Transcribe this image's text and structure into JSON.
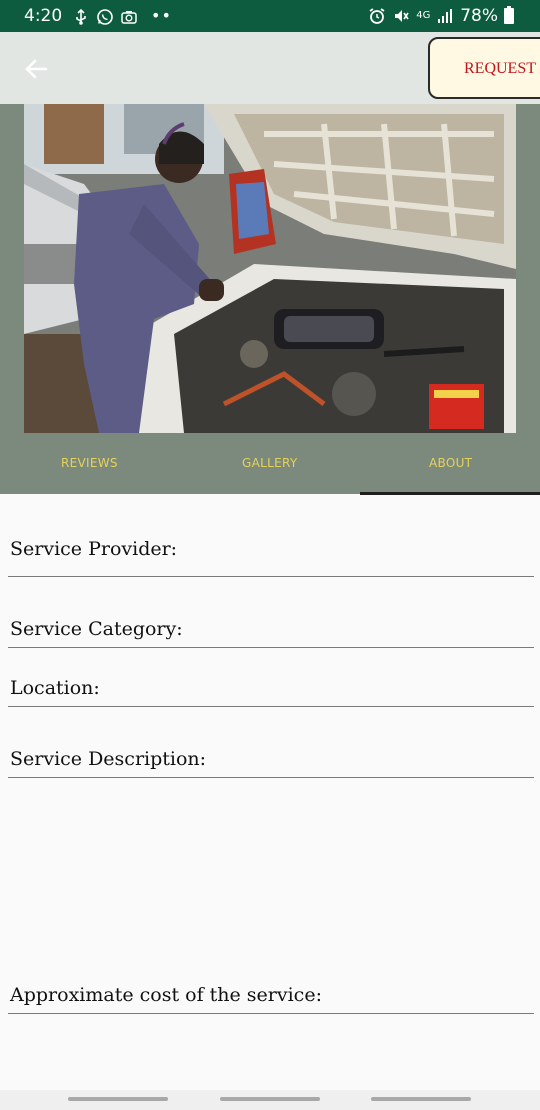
{
  "status_bar": {
    "time": "4:20",
    "dots": "••",
    "network": "4G",
    "battery": "78%",
    "icons": [
      "usb-icon",
      "whatsapp-icon",
      "camera-icon",
      "alarm-icon",
      "mute-icon",
      "signal-icon",
      "battery-icon"
    ]
  },
  "app_bar": {
    "back_icon": "arrow-left-icon",
    "request_label": "REQUEST"
  },
  "hero": {
    "image_description_icon": "mechanic-engine-photo"
  },
  "tabs": [
    {
      "label": "REVIEWS",
      "selected": false
    },
    {
      "label": "GALLERY",
      "selected": false
    },
    {
      "label": "ABOUT",
      "selected": true
    }
  ],
  "details": {
    "service_provider": "Service Provider:",
    "service_category": "Service Category:",
    "location": "Location:",
    "service_description": "Service Description:",
    "approximate_cost": "Approximate cost of the service:"
  },
  "colors": {
    "status_bar": "#0d5c3f",
    "app_bar": "#e1e6e3",
    "hero_bg": "#7b8a7d",
    "tab_text": "#e6d25a",
    "request_text": "#c0161c",
    "request_bg": "#fff8e3"
  }
}
